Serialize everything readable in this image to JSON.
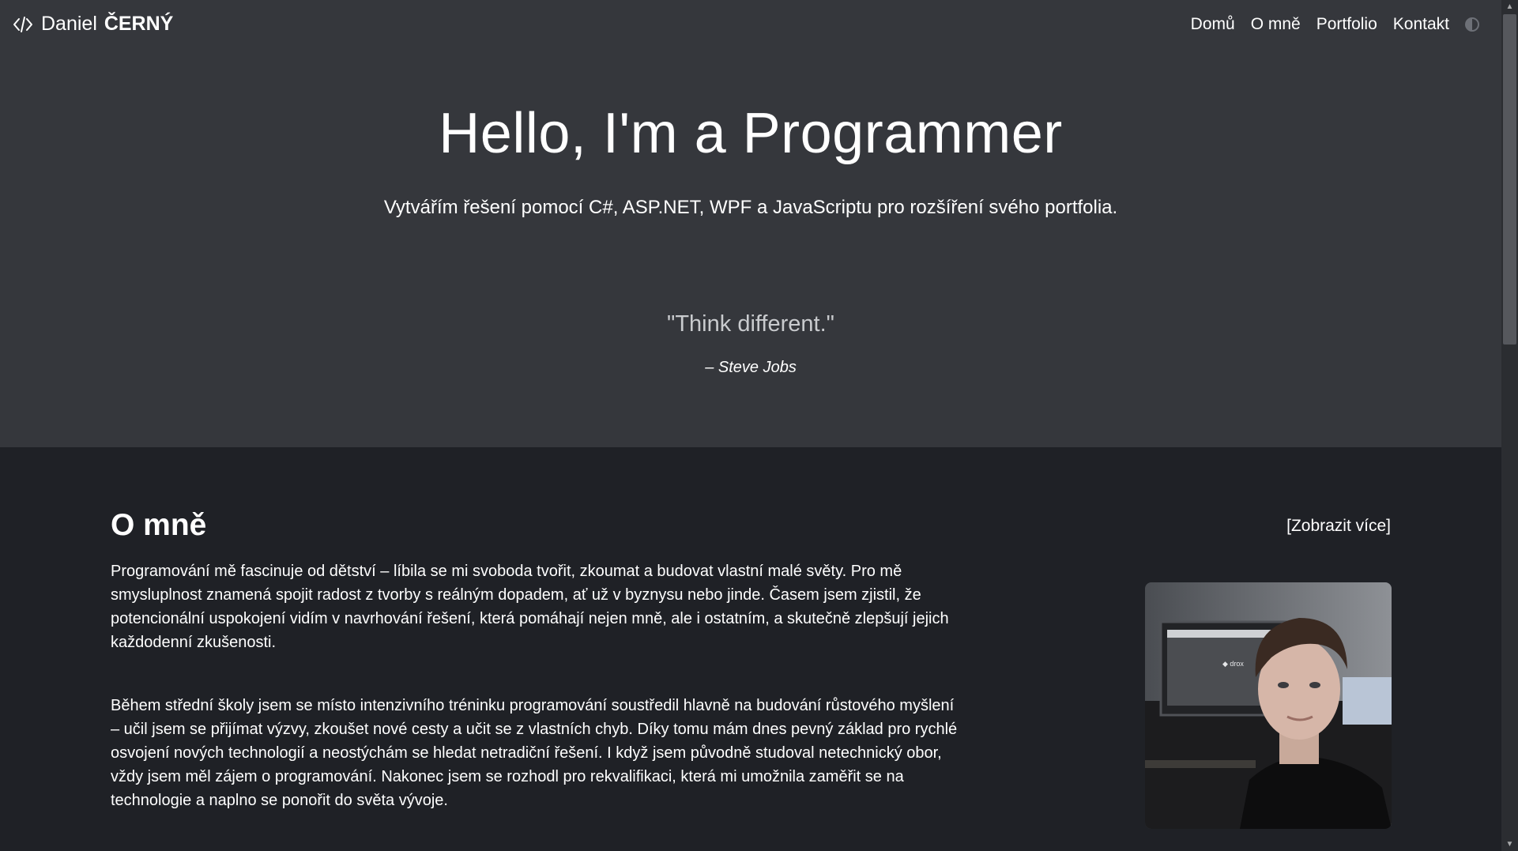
{
  "nav": {
    "brand_first": "Daniel",
    "brand_last": "ČERNÝ",
    "brand_icon": "code-icon",
    "links": [
      "Domů",
      "O mně",
      "Portfolio",
      "Kontakt"
    ],
    "theme_icon": "contrast-icon"
  },
  "hero": {
    "title": "Hello, I'm a Programmer",
    "subtitle": "Vytvářím řešení pomocí C#, ASP.NET, WPF a JavaScriptu pro rozšíření svého portfolia.",
    "quote": "\"Think different.\"",
    "quote_author": "– Steve Jobs"
  },
  "about": {
    "title": "O mně",
    "more_link": "[Zobrazit více]",
    "paragraphs": [
      "Programování mě fascinuje od dětství – líbila se mi svoboda tvořit, zkoumat a budovat vlastní malé světy. Pro mě smysluplnost znamená spojit radost z tvorby s reálným dopadem, ať už v byznysu nebo jinde. Časem jsem zjistil, že potencionální uspokojení vidím v navrhování řešení, která pomáhají nejen mně, ale i ostatním, a skutečně zlepšují jejich každodenní zkušenosti.",
      "Během střední školy jsem se místo intenzivního tréninku programování soustředil hlavně na budování růstového myšlení – učil jsem se přijímat výzvy, zkoušet nové cesty a učit se z vlastních chyb. Díky tomu mám dnes pevný základ pro rychlé osvojení nových technologií a neostýchám se hledat netradiční řešení. I když jsem původně studoval netechnický obor, vždy jsem měl zájem o programování. Nakonec jsem se rozhodl pro rekvalifikaci, která mi umožnila zaměřit se na technologie a naplno se ponořit do světa vývoje."
    ]
  },
  "colors": {
    "hero_bg": "#35373c",
    "section_bg": "#1f2126",
    "text": "#ffffff",
    "quote": "#c9cbce"
  }
}
